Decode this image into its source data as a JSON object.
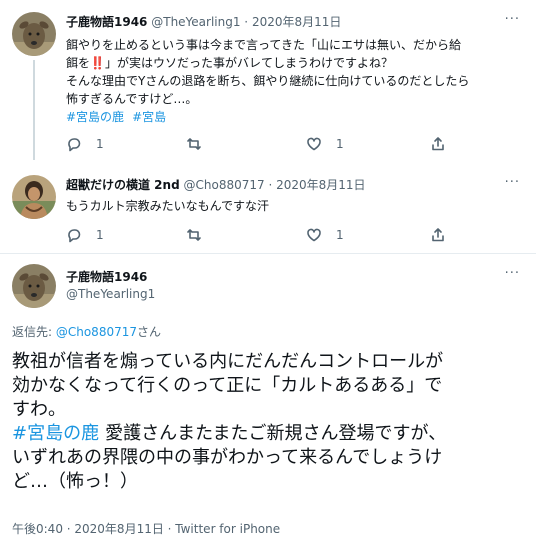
{
  "tweet1": {
    "name": "子鹿物語1946",
    "handle": "@TheYearling1",
    "date": "2020年8月11日",
    "lines": [
      "餌やりを止めるという事は今まで言ってきた「山にエサは無い、だから給",
      "餌を‼️」が実はウソだった事がバレてしまうわけですよね？",
      "そんな理由でYさんの退路を断ち、餌やり継続に仕向けているのだとしたら",
      "怖すぎるんですけど…。"
    ],
    "hashtags": [
      "#宮島の鹿",
      "#宮島"
    ],
    "counts": {
      "reply": "1",
      "retweet": "",
      "like": "1"
    }
  },
  "tweet2": {
    "name": "超獣だけの横道 2nd",
    "handle": "@Cho880717",
    "date": "2020年8月11日",
    "text": "もうカルト宗教みたいなもんですな汗",
    "counts": {
      "reply": "1",
      "retweet": "",
      "like": "1"
    }
  },
  "main": {
    "name": "子鹿物語1946",
    "handle": "@TheYearling1",
    "reply_prefix": "返信先: ",
    "reply_handle": "@Cho880717",
    "reply_suffix": "さん",
    "lines": [
      "教祖が信者を煽っている内にだんだんコントロールが",
      "効かなくなって行くのって正に「カルトあるある」で",
      "すわ。"
    ],
    "hashtag": "#宮島の鹿",
    "line4_rest": "愛護さんまたまたご新規さん登場ですが、",
    "lines_after": [
      "いずれあの界隈の中の事がわかって来るんでしょうけ",
      "ど…（怖っ！）"
    ],
    "timestamp": "午後0:40 · 2020年8月11日 · Twitter for iPhone"
  },
  "meta_separator": " · ",
  "more_glyph": "···"
}
